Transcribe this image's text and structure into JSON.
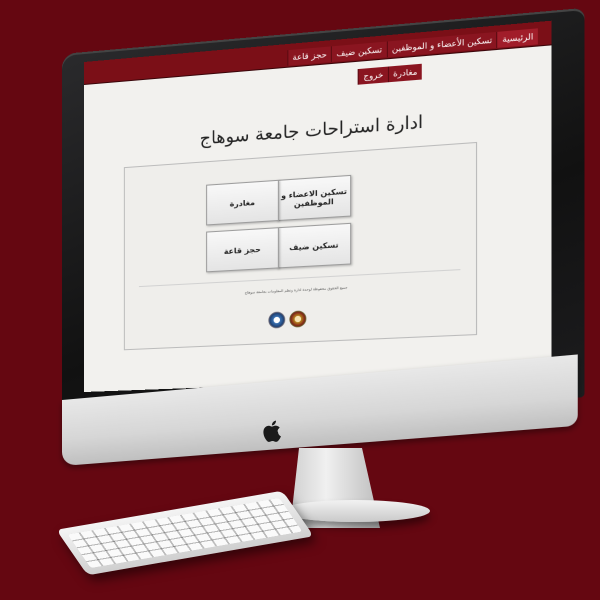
{
  "nav": {
    "row1": [
      "الرئيسية",
      "تسكين الأعضاء و الموظفين",
      "تسكين ضيف",
      "حجز قاعة"
    ],
    "row2": [
      "مغادرة",
      "خروج"
    ]
  },
  "page": {
    "title": "ادارة استراحات جامعة سوهاج"
  },
  "tiles": {
    "staff": "تسكين الاعضاء و الموظفين",
    "depart": "مغادرة",
    "guest": "تسكين ضيف",
    "hall": "حجز قاعة"
  },
  "footer": {
    "notice": "جميع الحقوق محفوظة لوحدة ادارة ونظم المعلومات بجامعة سوهاج"
  },
  "colors": {
    "background": "#650711",
    "topbar": "#7b0f17"
  }
}
